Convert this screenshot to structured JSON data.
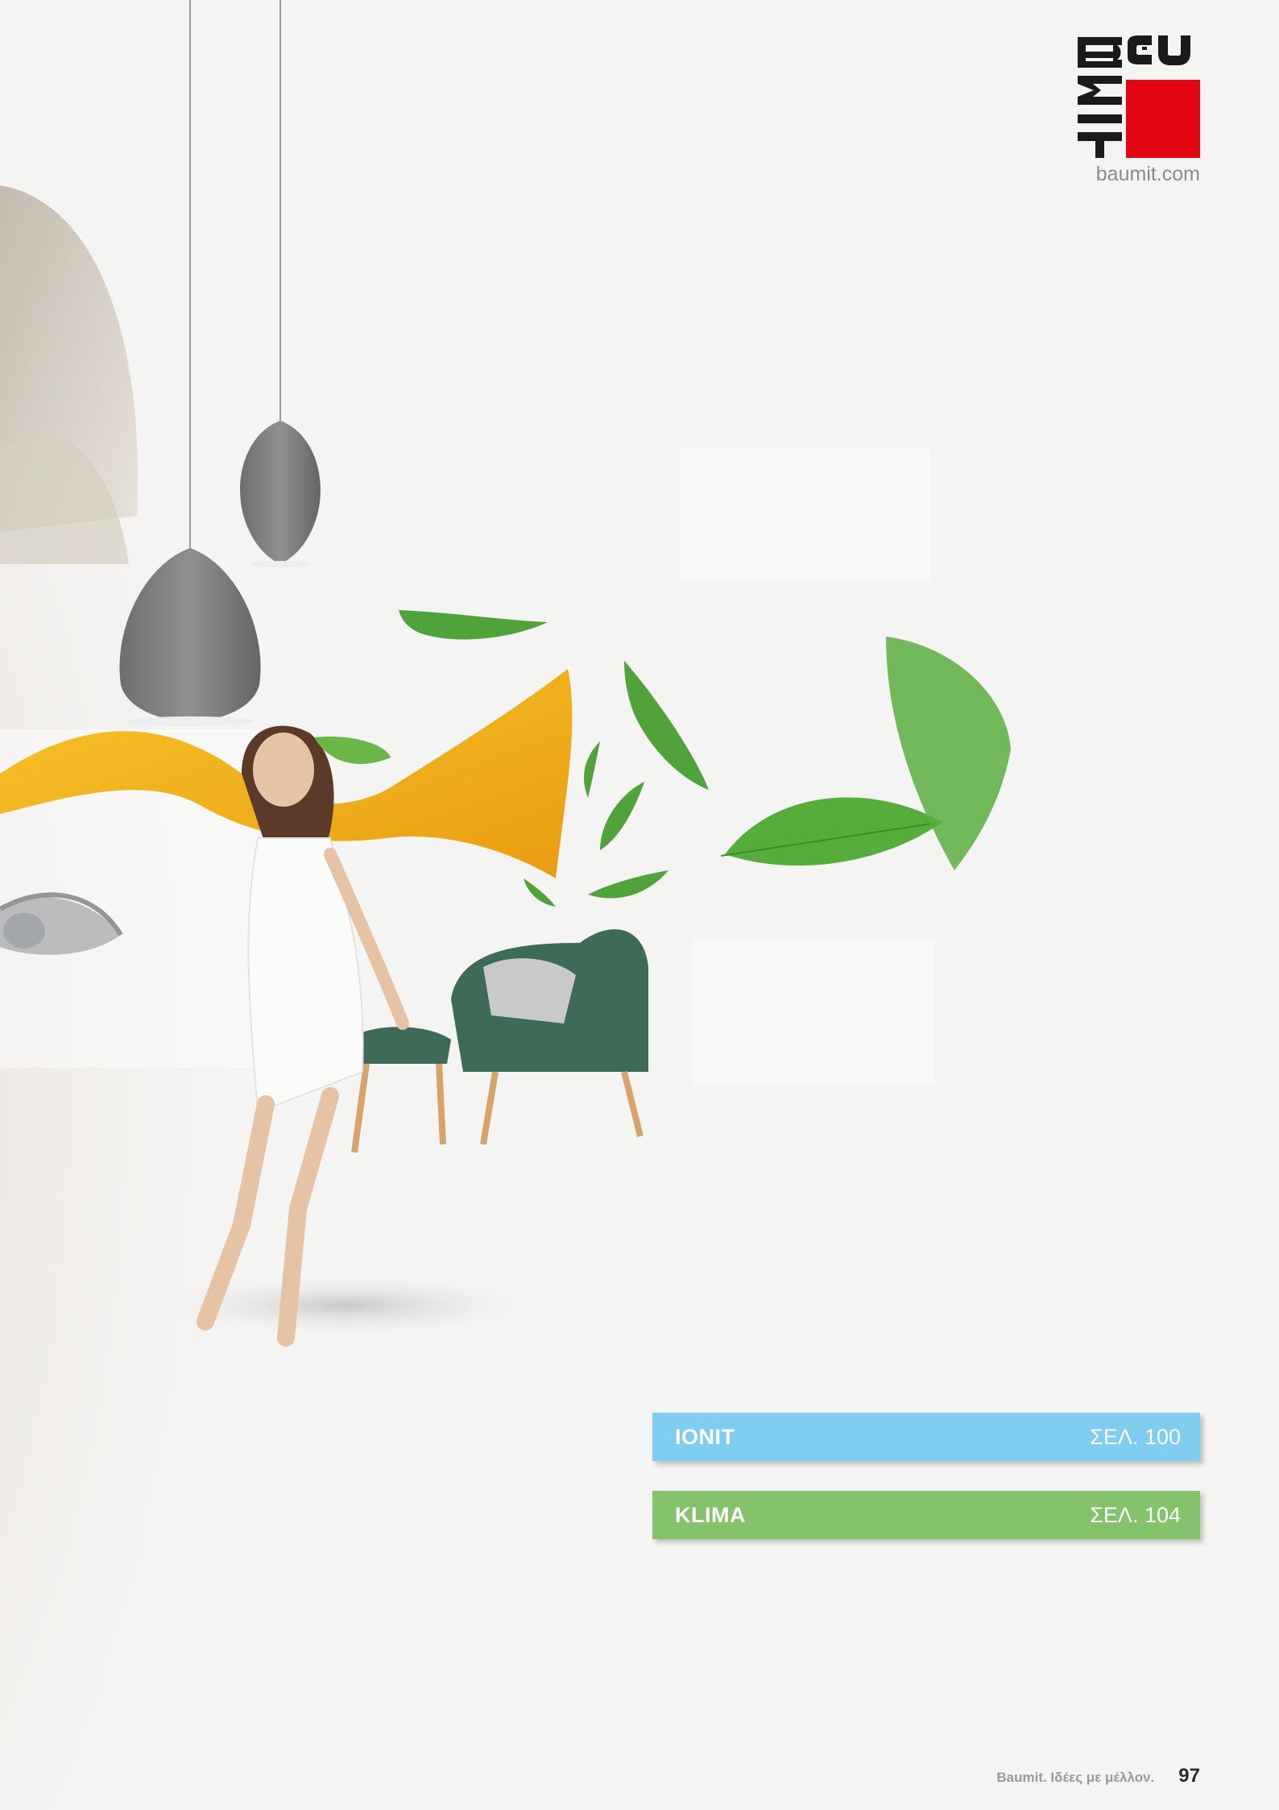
{
  "brand": {
    "logo_letters": "BAUMIT",
    "url": "baumit.com",
    "red": "#e30613",
    "black": "#1a1a1a"
  },
  "chapters": [
    {
      "title": "IONIT",
      "page": "ΣΕΛ. 100",
      "color": "#7fcdf1"
    },
    {
      "title": "KLIMA",
      "page": "ΣΕΛ. 104",
      "color": "#84c26c"
    }
  ],
  "footer": {
    "text": "Baumit. Ιδέες με μέλλον.",
    "page_number": "97"
  },
  "illustration": {
    "subject": "photo-collage",
    "colors": {
      "leaf": "#4fa33a",
      "fabric": "#f5b21b",
      "chair": "#3d6b58",
      "lamp": "#7c7c7e"
    }
  }
}
